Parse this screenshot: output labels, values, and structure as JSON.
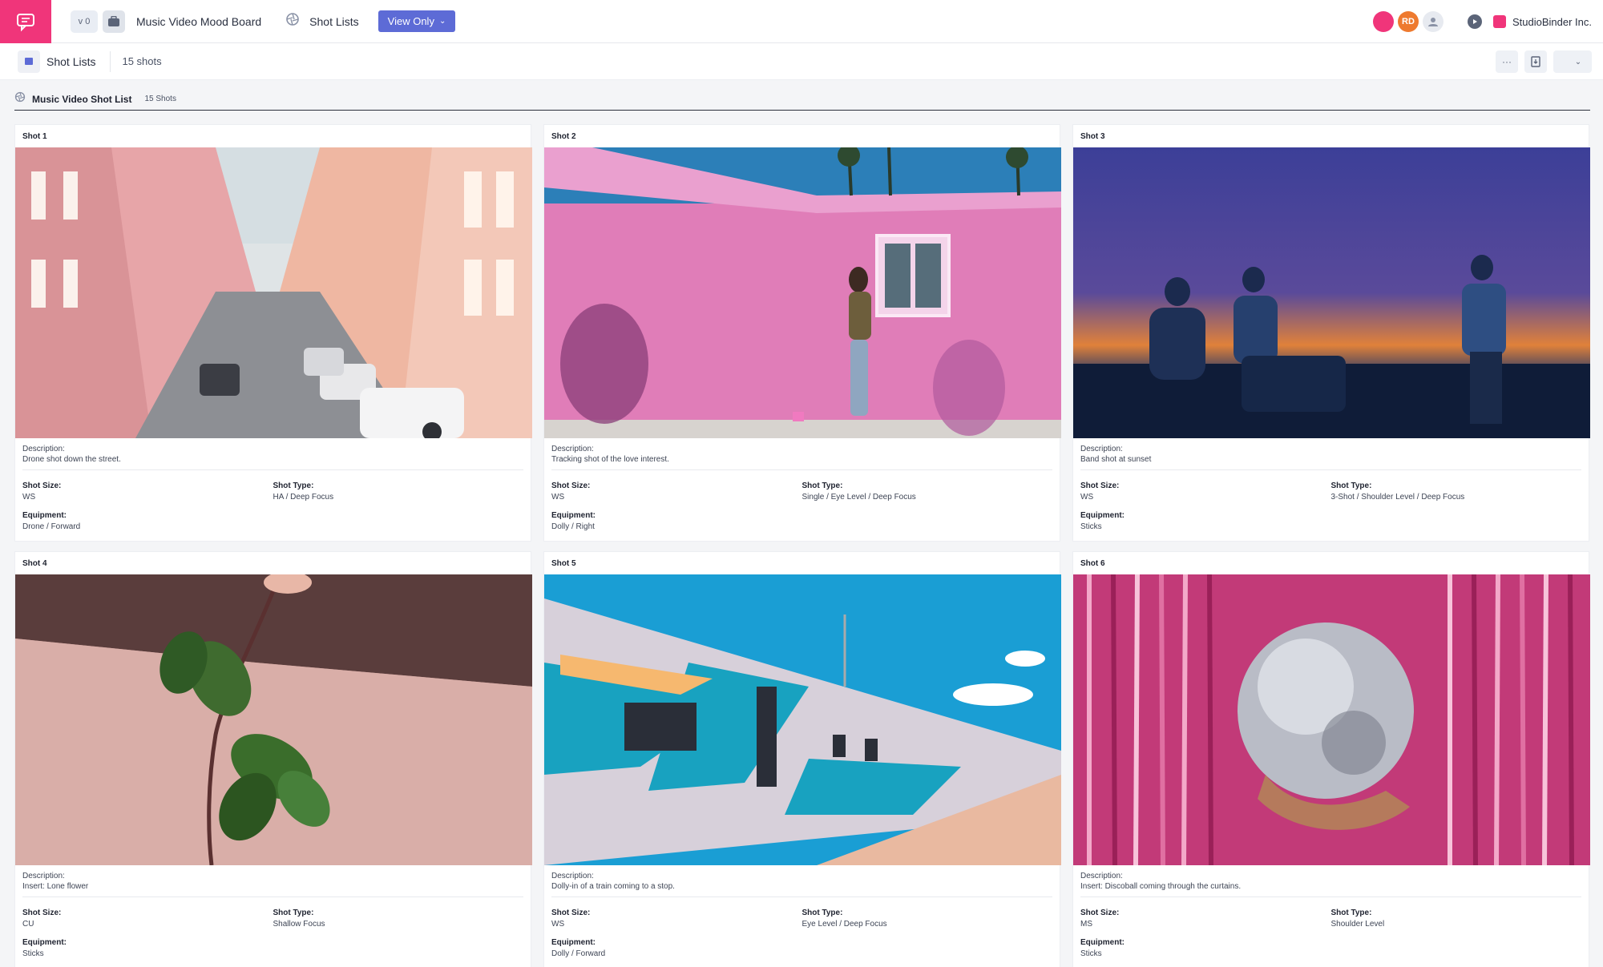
{
  "header": {
    "version": "v 0",
    "project_title": "Music Video Mood Board",
    "nav_label": "Shot Lists",
    "view_mode": "View Only",
    "avatars": [
      "",
      "RD",
      ""
    ],
    "company": "StudioBinder Inc."
  },
  "subbar": {
    "title": "Shot Lists",
    "count": "15 shots",
    "more": "···"
  },
  "list": {
    "title": "Music Video Shot List",
    "count": "15 Shots"
  },
  "labels": {
    "description": "Description:",
    "shot_size": "Shot Size:",
    "shot_type": "Shot Type:",
    "equipment": "Equipment:"
  },
  "shots": [
    {
      "title": "Shot  1",
      "description": "Drone shot down the street.",
      "shot_size": "WS",
      "shot_type": "HA / Deep Focus",
      "equipment": "Drone / Forward"
    },
    {
      "title": "Shot  2",
      "description": "Tracking shot of the love interest.",
      "shot_size": "WS",
      "shot_type": "Single / Eye Level / Deep Focus",
      "equipment": "Dolly / Right"
    },
    {
      "title": "Shot  3",
      "description": "Band shot at sunset",
      "shot_size": "WS",
      "shot_type": "3-Shot / Shoulder Level / Deep Focus",
      "equipment": "Sticks"
    },
    {
      "title": "Shot  4",
      "description": "Insert: Lone flower",
      "shot_size": "CU",
      "shot_type": "Shallow Focus",
      "equipment": "Sticks"
    },
    {
      "title": "Shot  5",
      "description": "Dolly-in of a train coming to a stop.",
      "shot_size": "WS",
      "shot_type": "Eye Level / Deep Focus",
      "equipment": "Dolly / Forward"
    },
    {
      "title": "Shot  6",
      "description": "Insert: Discoball coming through the curtains.",
      "shot_size": "MS",
      "shot_type": "Shoulder Level",
      "equipment": "Sticks"
    }
  ],
  "colors": {
    "brand": "#f0357a",
    "accent": "#5d6bd6"
  }
}
